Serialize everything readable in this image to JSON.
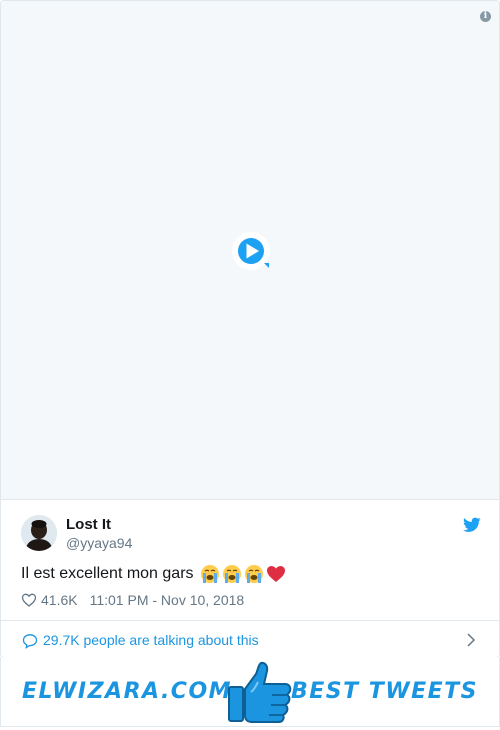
{
  "tweet": {
    "display_name": "Lost It",
    "screen_name": "@yyaya94",
    "text": "Il est excellent mon gars",
    "emojis": [
      "loudly-crying-face",
      "loudly-crying-face",
      "loudly-crying-face",
      "red-heart"
    ],
    "likes": "41.6K",
    "timestamp": "11:01 PM - Nov 10, 2018",
    "talking": "29.7K people are talking about this"
  },
  "banner": {
    "left_text": "ELWIZARA.COM",
    "right_text": "BEST TWEETS"
  },
  "icons": {
    "info": "info-icon",
    "play": "play-icon",
    "bird": "twitter-bird-icon",
    "heart": "heart-outline-icon",
    "comment": "comment-bubble-icon",
    "chevron": "chevron-right-icon",
    "thumb": "thumbs-up-icon"
  },
  "colors": {
    "accent": "#1b95e0",
    "muted": "#657786",
    "text": "#14171a",
    "border": "#e1e8ed",
    "media_bg": "#f5f8fa"
  }
}
